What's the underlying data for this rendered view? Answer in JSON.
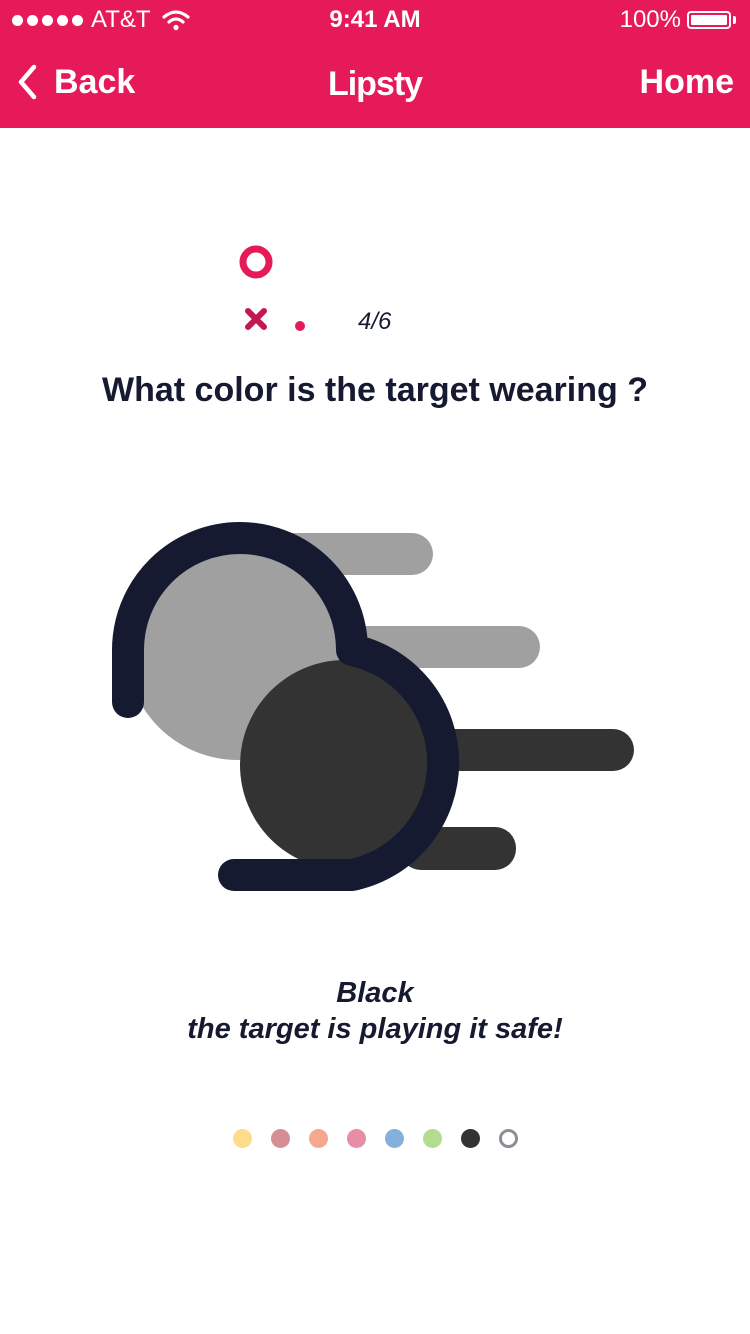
{
  "status_bar": {
    "carrier": "AT&T",
    "time": "9:41 AM",
    "battery": "100%"
  },
  "nav": {
    "back_label": "Back",
    "title": "Lipsty",
    "home_label": "Home",
    "color": "#e61a59"
  },
  "quiz": {
    "progress": "4/6",
    "question": "What color is the target wearing ?",
    "answer_color": "Black",
    "answer_comment": "the target is playing it safe!"
  },
  "color_options": [
    {
      "name": "yellow",
      "color": "#fddc8c",
      "selected": false
    },
    {
      "name": "mauve",
      "color": "#d48e96",
      "selected": false
    },
    {
      "name": "peach",
      "color": "#f4a98f",
      "selected": false
    },
    {
      "name": "pink",
      "color": "#e78da6",
      "selected": false
    },
    {
      "name": "blue",
      "color": "#86b0dc",
      "selected": false
    },
    {
      "name": "green",
      "color": "#b3dd8e",
      "selected": false
    },
    {
      "name": "black",
      "color": "#333333",
      "selected": false
    },
    {
      "name": "white",
      "color": "#ffffff",
      "selected": true
    }
  ]
}
